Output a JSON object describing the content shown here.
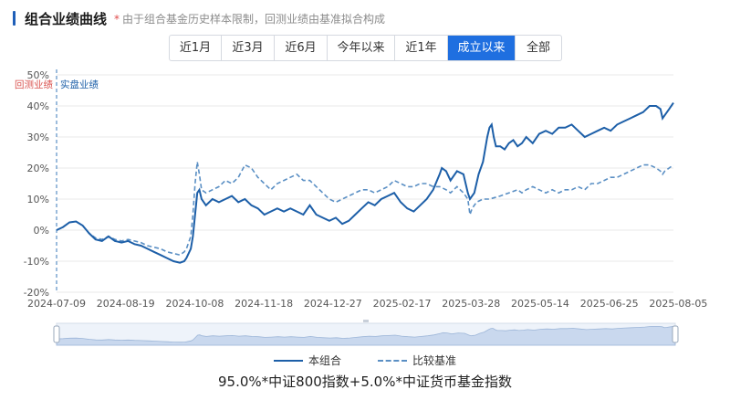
{
  "header": {
    "title": "组合业绩曲线",
    "note_star": "*",
    "note": "由于组合基金历史样本限制，回测业绩由基准拟合构成"
  },
  "range_tabs": [
    {
      "label": "近1月",
      "active": false
    },
    {
      "label": "近3月",
      "active": false
    },
    {
      "label": "近6月",
      "active": false
    },
    {
      "label": "今年以来",
      "active": false
    },
    {
      "label": "近1年",
      "active": false
    },
    {
      "label": "成立以来",
      "active": true
    },
    {
      "label": "全部",
      "active": false
    }
  ],
  "colors": {
    "portfolio": "#1d5fa8",
    "benchmark": "#5a8fc4",
    "backtest_label": "#d9534f",
    "live_label": "#1d5fa8",
    "grid": "#e8e8e8",
    "tab_active": "#1f6fe0"
  },
  "footnote": "95.0%*中证800指数+5.0%*中证货币基金指数",
  "chart_data": {
    "type": "line",
    "markers": {
      "backtest": "回测业绩",
      "live": "实盘业绩"
    },
    "x_ticks": [
      "2024-07-09",
      "2024-08-19",
      "2024-10-08",
      "2024-11-18",
      "2024-12-27",
      "2025-02-17",
      "2025-03-28",
      "2025-05-14",
      "2025-06-25",
      "2025-08-05"
    ],
    "y_ticks": [
      "-20%",
      "-10%",
      "0%",
      "10%",
      "20%",
      "30%",
      "40%",
      "50%"
    ],
    "ylim": [
      -20,
      50
    ],
    "y_unit": "%",
    "grid": true,
    "legend_position": "bottom",
    "has_range_slider": true,
    "series": [
      {
        "name": "本组合",
        "style": "solid",
        "values": [
          [
            0,
            0
          ],
          [
            3,
            1
          ],
          [
            6,
            2.5
          ],
          [
            9,
            2.8
          ],
          [
            12,
            1.5
          ],
          [
            15,
            -1
          ],
          [
            18,
            -3
          ],
          [
            21,
            -3.5
          ],
          [
            24,
            -2
          ],
          [
            27,
            -3.5
          ],
          [
            30,
            -4
          ],
          [
            33,
            -3.5
          ],
          [
            36,
            -4.5
          ],
          [
            39,
            -5
          ],
          [
            42,
            -6
          ],
          [
            45,
            -7
          ],
          [
            48,
            -8
          ],
          [
            51,
            -9
          ],
          [
            54,
            -10
          ],
          [
            57,
            -10.5
          ],
          [
            59,
            -10
          ],
          [
            60,
            -9
          ],
          [
            62,
            -6
          ],
          [
            63,
            -2
          ],
          [
            64,
            5
          ],
          [
            65,
            12
          ],
          [
            66,
            13
          ],
          [
            67,
            10
          ],
          [
            69,
            8
          ],
          [
            72,
            10
          ],
          [
            75,
            9
          ],
          [
            78,
            10
          ],
          [
            81,
            11
          ],
          [
            84,
            9
          ],
          [
            87,
            10
          ],
          [
            90,
            8
          ],
          [
            93,
            7
          ],
          [
            96,
            5
          ],
          [
            99,
            6
          ],
          [
            102,
            7
          ],
          [
            105,
            6
          ],
          [
            108,
            7
          ],
          [
            111,
            6
          ],
          [
            114,
            5
          ],
          [
            117,
            8
          ],
          [
            120,
            5
          ],
          [
            123,
            4
          ],
          [
            126,
            3
          ],
          [
            129,
            4
          ],
          [
            132,
            2
          ],
          [
            135,
            3
          ],
          [
            138,
            5
          ],
          [
            141,
            7
          ],
          [
            144,
            9
          ],
          [
            147,
            8
          ],
          [
            150,
            10
          ],
          [
            153,
            11
          ],
          [
            156,
            12
          ],
          [
            159,
            9
          ],
          [
            162,
            7
          ],
          [
            165,
            6
          ],
          [
            168,
            8
          ],
          [
            171,
            10
          ],
          [
            174,
            13
          ],
          [
            177,
            18
          ],
          [
            178,
            20
          ],
          [
            180,
            19
          ],
          [
            182,
            16
          ],
          [
            185,
            19
          ],
          [
            188,
            18
          ],
          [
            190,
            12
          ],
          [
            191,
            10
          ],
          [
            193,
            12
          ],
          [
            195,
            18
          ],
          [
            197,
            22
          ],
          [
            199,
            30
          ],
          [
            200,
            33
          ],
          [
            201,
            34
          ],
          [
            202,
            30
          ],
          [
            203,
            27
          ],
          [
            205,
            27
          ],
          [
            207,
            26
          ],
          [
            209,
            28
          ],
          [
            211,
            29
          ],
          [
            213,
            27
          ],
          [
            215,
            28
          ],
          [
            217,
            30
          ],
          [
            220,
            28
          ],
          [
            223,
            31
          ],
          [
            226,
            32
          ],
          [
            229,
            31
          ],
          [
            232,
            33
          ],
          [
            235,
            33
          ],
          [
            238,
            34
          ],
          [
            241,
            32
          ],
          [
            244,
            30
          ],
          [
            247,
            31
          ],
          [
            250,
            32
          ],
          [
            253,
            33
          ],
          [
            256,
            32
          ],
          [
            259,
            34
          ],
          [
            262,
            35
          ],
          [
            265,
            36
          ],
          [
            268,
            37
          ],
          [
            271,
            38
          ],
          [
            274,
            40
          ],
          [
            277,
            40
          ],
          [
            279,
            39
          ],
          [
            280,
            36
          ],
          [
            281,
            37
          ],
          [
            283,
            39
          ],
          [
            285,
            41
          ]
        ]
      },
      {
        "name": "比较基准",
        "style": "dashed",
        "values": [
          [
            0,
            0
          ],
          [
            3,
            1
          ],
          [
            6,
            2.5
          ],
          [
            9,
            2.8
          ],
          [
            12,
            1.5
          ],
          [
            15,
            -1
          ],
          [
            18,
            -2.5
          ],
          [
            21,
            -3
          ],
          [
            24,
            -2
          ],
          [
            27,
            -3
          ],
          [
            30,
            -3.5
          ],
          [
            33,
            -3
          ],
          [
            36,
            -3.5
          ],
          [
            39,
            -4
          ],
          [
            42,
            -5
          ],
          [
            45,
            -5.5
          ],
          [
            48,
            -6
          ],
          [
            51,
            -7
          ],
          [
            54,
            -7.5
          ],
          [
            57,
            -8
          ],
          [
            59,
            -7
          ],
          [
            60,
            -6
          ],
          [
            62,
            -2
          ],
          [
            63,
            5
          ],
          [
            64,
            15
          ],
          [
            65,
            22
          ],
          [
            66,
            18
          ],
          [
            67,
            13
          ],
          [
            69,
            12
          ],
          [
            72,
            13
          ],
          [
            75,
            14
          ],
          [
            78,
            16
          ],
          [
            81,
            15
          ],
          [
            84,
            17
          ],
          [
            87,
            21
          ],
          [
            90,
            20
          ],
          [
            93,
            17
          ],
          [
            96,
            15
          ],
          [
            99,
            13
          ],
          [
            102,
            15
          ],
          [
            105,
            16
          ],
          [
            108,
            17
          ],
          [
            111,
            18
          ],
          [
            114,
            16
          ],
          [
            117,
            16
          ],
          [
            120,
            14
          ],
          [
            123,
            12
          ],
          [
            126,
            10
          ],
          [
            129,
            9
          ],
          [
            132,
            10
          ],
          [
            135,
            11
          ],
          [
            138,
            12
          ],
          [
            141,
            13
          ],
          [
            144,
            13
          ],
          [
            147,
            12
          ],
          [
            150,
            13
          ],
          [
            153,
            14
          ],
          [
            156,
            16
          ],
          [
            159,
            15
          ],
          [
            162,
            14
          ],
          [
            165,
            14
          ],
          [
            168,
            15
          ],
          [
            171,
            15
          ],
          [
            174,
            14
          ],
          [
            177,
            14
          ],
          [
            180,
            13
          ],
          [
            182,
            12
          ],
          [
            185,
            14
          ],
          [
            188,
            12
          ],
          [
            190,
            10
          ],
          [
            191,
            5
          ],
          [
            192,
            7
          ],
          [
            194,
            9
          ],
          [
            197,
            10
          ],
          [
            200,
            10
          ],
          [
            205,
            11
          ],
          [
            209,
            12
          ],
          [
            213,
            13
          ],
          [
            215,
            12
          ],
          [
            217,
            13
          ],
          [
            220,
            14
          ],
          [
            223,
            13
          ],
          [
            226,
            12
          ],
          [
            229,
            13
          ],
          [
            232,
            12
          ],
          [
            235,
            13
          ],
          [
            238,
            13
          ],
          [
            241,
            14
          ],
          [
            244,
            13
          ],
          [
            247,
            15
          ],
          [
            250,
            15
          ],
          [
            253,
            16
          ],
          [
            256,
            17
          ],
          [
            259,
            17
          ],
          [
            262,
            18
          ],
          [
            265,
            19
          ],
          [
            268,
            20
          ],
          [
            271,
            21
          ],
          [
            274,
            21
          ],
          [
            277,
            20
          ],
          [
            279,
            19
          ],
          [
            280,
            18
          ],
          [
            281,
            19
          ],
          [
            283,
            20
          ],
          [
            285,
            21
          ]
        ]
      }
    ]
  }
}
